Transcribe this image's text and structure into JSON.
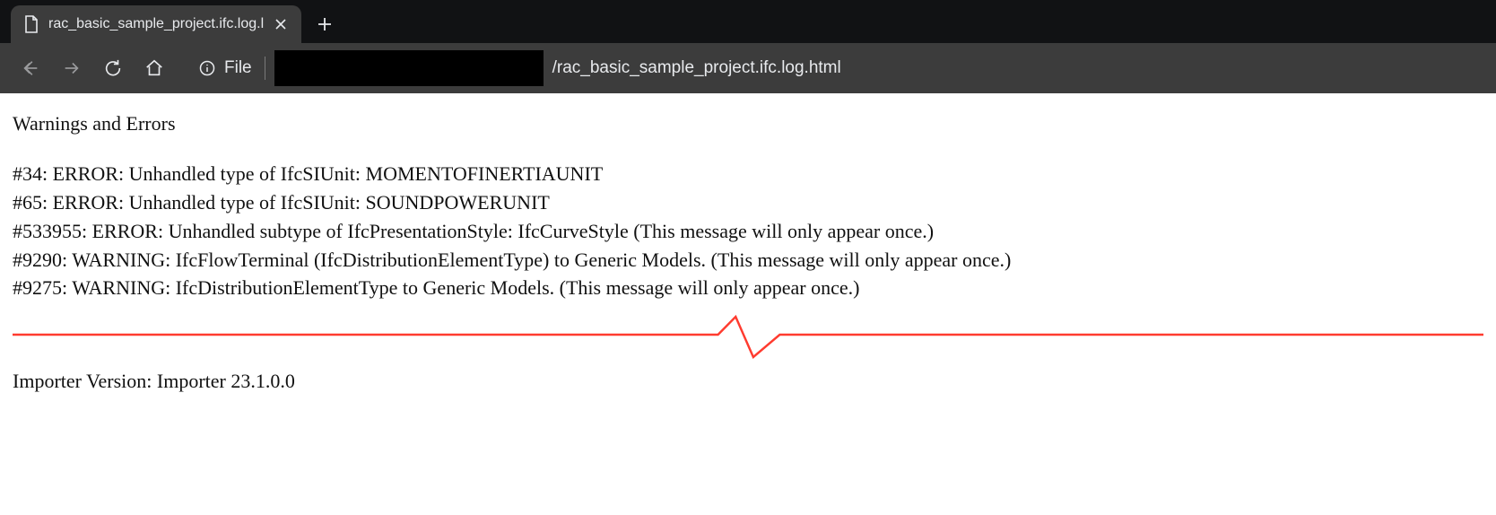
{
  "tab": {
    "title": "rac_basic_sample_project.ifc.log.l"
  },
  "address": {
    "scheme_label": "File",
    "path_suffix": "/rac_basic_sample_project.ifc.log.html"
  },
  "page": {
    "heading": "Warnings and Errors",
    "log_lines": [
      "#34: ERROR: Unhandled type of IfcSIUnit: MOMENTOFINERTIAUNIT",
      "#65: ERROR: Unhandled type of IfcSIUnit: SOUNDPOWERUNIT",
      "#533955: ERROR: Unhandled subtype of IfcPresentationStyle: IfcCurveStyle (This message will only appear once.)",
      "#9290: WARNING: IfcFlowTerminal (IfcDistributionElementType) to Generic Models. (This message will only appear once.)",
      "#9275: WARNING: IfcDistributionElementType to Generic Models. (This message will only appear once.)"
    ],
    "footer": "Importer Version: Importer 23.1.0.0"
  },
  "colors": {
    "annotation_divider": "#ff3b2f"
  }
}
